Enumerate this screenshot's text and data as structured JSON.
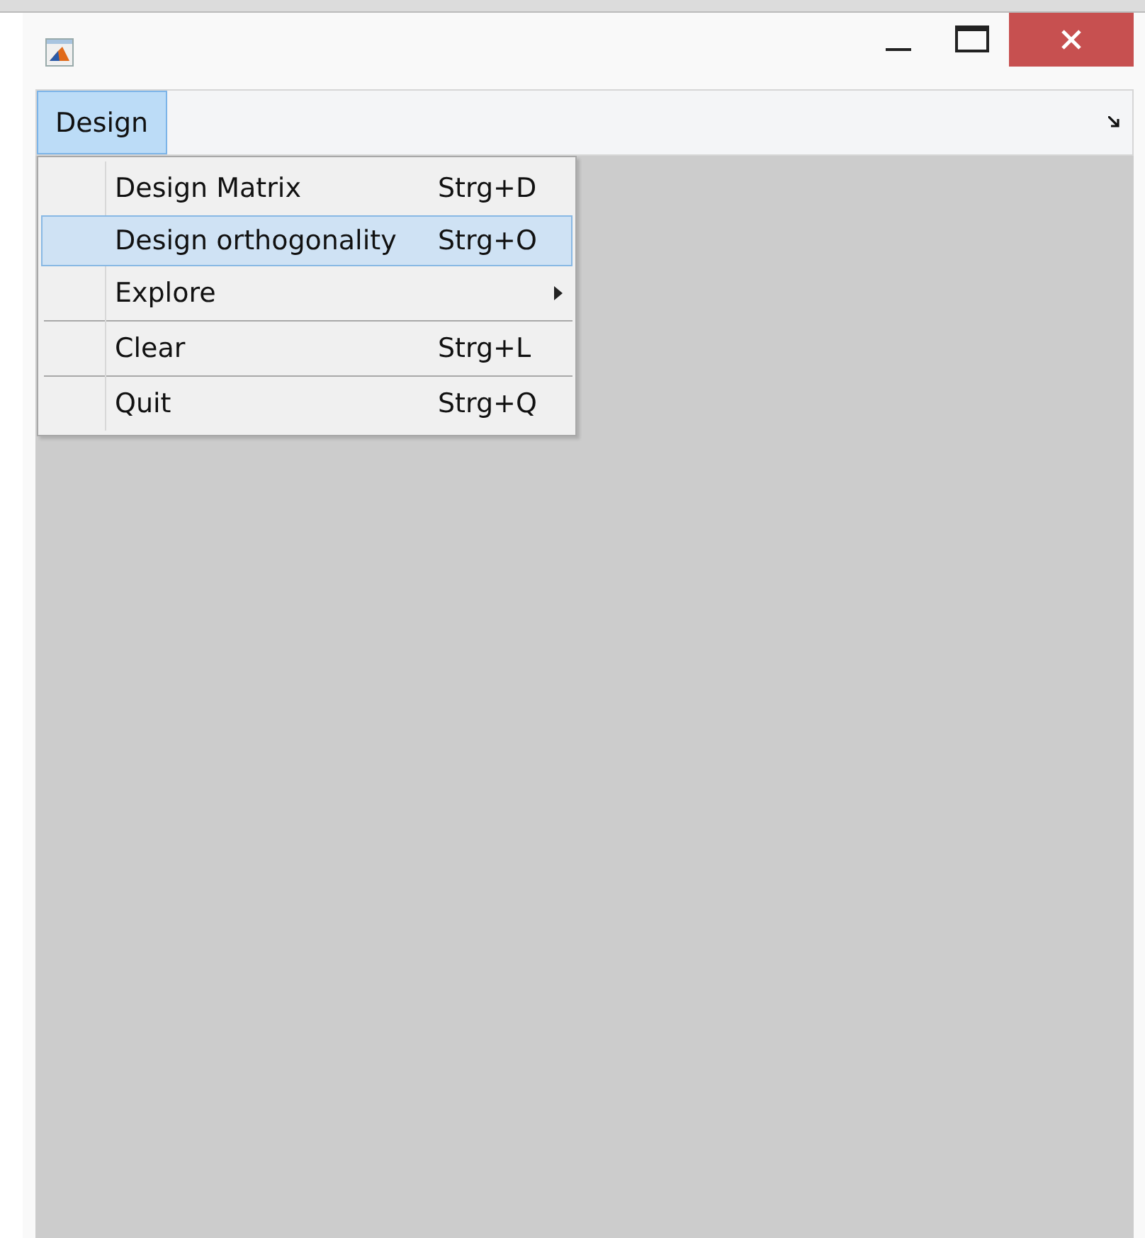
{
  "menu_bar": [
    {
      "label": "Design",
      "selected": true
    }
  ],
  "dropdown": [
    {
      "kind": "item",
      "label": "Design Matrix",
      "shortcut": "Strg+D",
      "selected": false
    },
    {
      "kind": "item",
      "label": "Design orthogonality",
      "shortcut": "Strg+O",
      "selected": true
    },
    {
      "kind": "submenu",
      "label": "Explore",
      "selected": false
    },
    {
      "kind": "separator"
    },
    {
      "kind": "item",
      "label": "Clear",
      "shortcut": "Strg+L",
      "selected": false
    },
    {
      "kind": "separator"
    },
    {
      "kind": "item",
      "label": "Quit",
      "shortcut": "Strg+Q",
      "selected": false
    }
  ]
}
